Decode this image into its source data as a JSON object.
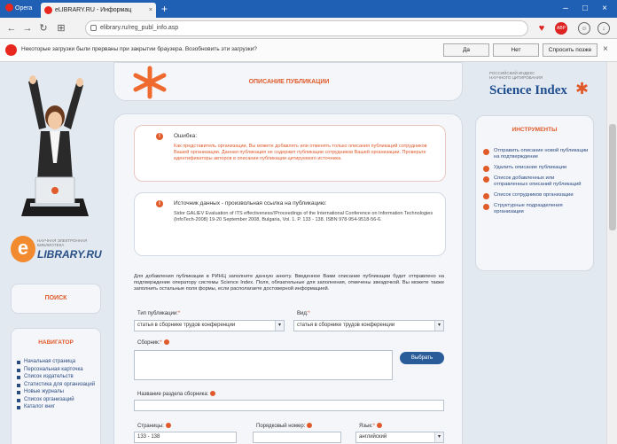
{
  "browser": {
    "menu_label": "Opera",
    "tab_title": "eLIBRARY.RU - Информац",
    "url": "elibrary.ru/reg_publ_info.asp",
    "notification": {
      "text": "Некоторые загрузки были прерваны при закрытии браузера. Возобновить эти загрузки?",
      "yes_label": "Да",
      "no_label": "Нет",
      "later_label": "Спросить позже"
    },
    "colors": {
      "tabbar": "#1f5fb4",
      "accent": "#e05a2a"
    }
  },
  "header": {
    "title": "ОПИСАНИЕ ПУБЛИКАЦИИ"
  },
  "elibrary_logo": {
    "small_text": "НАУЧНАЯ ЭЛЕКТРОННАЯ БИБЛИОТЕКА",
    "big_text": "LIBRARY.RU"
  },
  "left": {
    "search_label": "ПОИСК",
    "nav_title": "НАВИГАТОР",
    "nav_items": [
      "Начальная страница",
      "Персональная карточка",
      "Список издательств",
      "Статистика для организаций",
      "Новые журналы",
      "Список организаций",
      "Каталог книг"
    ]
  },
  "science_index": {
    "small_text": "РОССИЙСКИЙ ИНДЕКС НАУЧНОГО ЦИТИРОВАНИЯ",
    "big_text": "Science Index"
  },
  "tools": {
    "title": "ИНСТРУМЕНТЫ",
    "items": [
      "Отправить описание новой публикации на подтверждение",
      "Удалить описание публикации",
      "Список добавленных или отправленных описаний публикаций",
      "Список сотрудников организации",
      "Структурные подразделения организации"
    ]
  },
  "error": {
    "title": "Ошибка:",
    "text": "Как представитель организации, Вы можете добавлять или отменять только описания публикаций сотрудников Вашей организации. Данная публикация не содержит публикации сотрудников Вашей организации. Проверьте идентификаторы авторов в описании публикации цитируемого источника."
  },
  "source": {
    "title": "Источник данных - произвольная ссылка на публикацию:",
    "text": "Sidor GALIEV Evaluation of ITS effectiveness//Proceedings of the International Conference on Information Technologies (InfoTech-2008) 19-20 September 2008, Bulgaria, Vol. 1. P. 133 - 138. ISBN 978-954-9518-56-6."
  },
  "form": {
    "intro": "Для добавления публикации в РИНЦ заполните данную анкету. Введенное Вами описание публикации будет отправлено на подтверждение оператору системы Science Index. Поля, обязательные для заполнения, отмечены звездочкой. Вы можете также заполнить остальные поля формы, если располагаете достоверной информацией.",
    "type_label": "Тип публикации:",
    "type_value": "статья в сборнике трудов конференции",
    "kind_label": "Вид:",
    "kind_value": "статья в сборнике трудов конференции",
    "collection_label": "Сборник:",
    "choose_button": "Выбрать",
    "section_label": "Название раздела сборника:",
    "pages_label": "Страницы:",
    "pages_value": "133 - 138",
    "order_label": "Порядковый номер:",
    "lang_label": "Язык:",
    "lang_value": "английский",
    "required_mark": "*"
  }
}
